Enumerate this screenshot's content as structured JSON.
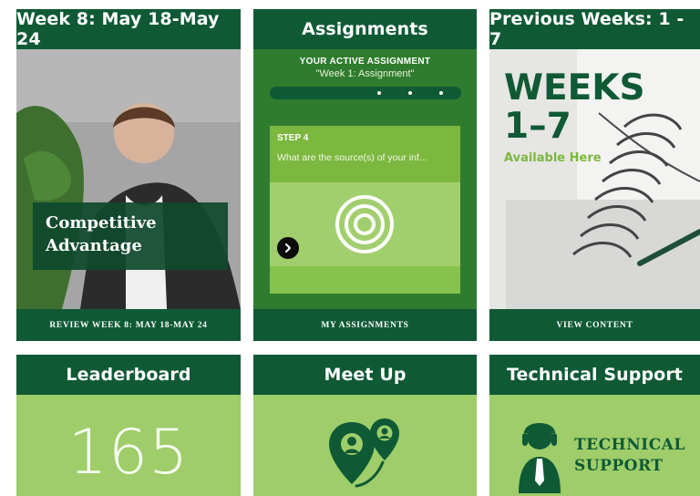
{
  "tiles": {
    "week8": {
      "title": "Week 8: May 18-May 24",
      "caption_line1": "Competitive",
      "caption_line2": "Advantage",
      "footer": "REVIEW WEEK 8: MAY 18-MAY 24"
    },
    "assignments": {
      "title": "Assignments",
      "active_label": "YOUR ACTIVE ASSIGNMENT",
      "active_name": "\"Week 1: Assignment\"",
      "step_label": "STEP 4",
      "step_question": "What are the source(s) of your inf...",
      "footer": "MY ASSIGNMENTS"
    },
    "previous": {
      "title": "Previous Weeks: 1 - 7",
      "big_line1": "WEEKS",
      "big_line2": "1–7",
      "available": "Available Here",
      "footer": "VIEW CONTENT"
    },
    "leaderboard": {
      "title": "Leaderboard",
      "score": "165"
    },
    "meetup": {
      "title": "Meet Up"
    },
    "support": {
      "title": "Technical Support",
      "text_line1": "TECHNICAL",
      "text_line2": "SUPPORT"
    }
  },
  "colors": {
    "dark_green": "#0f5a35",
    "mid_green": "#1f6b43",
    "light_green": "#9ecd6a",
    "accent_green": "#7cb83f"
  },
  "icons": {
    "assignment_next": "arrow-right-icon",
    "assignment_target": "target-icon",
    "meetup": "location-pins-icon",
    "support": "support-agent-icon"
  }
}
